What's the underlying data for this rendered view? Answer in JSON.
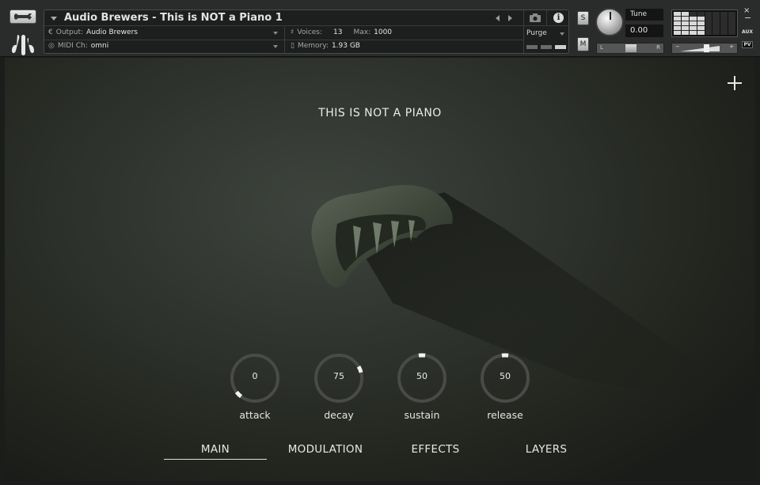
{
  "header": {
    "instrument_title": "Audio Brewers - This is NOT a Piano 1",
    "output_label": "Output:",
    "output_value": "Audio Brewers",
    "midi_label": "MIDI Ch:",
    "midi_value": "omni",
    "voices_label": "Voices:",
    "voices_value": "13",
    "max_label": "Max:",
    "max_value": "1000",
    "memory_label": "Memory:",
    "memory_value": "1.93 GB",
    "purge_label": "Purge",
    "solo_label": "S",
    "mute_label": "M",
    "tune_label": "Tune",
    "tune_value": "0.00",
    "pan_left": "L",
    "pan_right": "R",
    "vol_minus": "−",
    "vol_plus": "+",
    "close_label": "×",
    "aux_label": "AUX",
    "pv_label": "PV",
    "output_glyph": "€",
    "voices_glyph": "♯",
    "memory_glyph": "▯",
    "midi_glyph": "◎",
    "info_glyph": "i"
  },
  "main": {
    "title": "THIS IS NOT A PIANO",
    "knobs": [
      {
        "label": "attack",
        "value": "0",
        "fraction": 0.0
      },
      {
        "label": "decay",
        "value": "75",
        "fraction": 0.75
      },
      {
        "label": "sustain",
        "value": "50",
        "fraction": 0.5
      },
      {
        "label": "release",
        "value": "50",
        "fraction": 0.5
      }
    ]
  },
  "tabs": [
    {
      "label": "MAIN",
      "active": true
    },
    {
      "label": "MODULATION",
      "active": false
    },
    {
      "label": "EFFECTS",
      "active": false
    },
    {
      "label": "LAYERS",
      "active": false
    }
  ],
  "colors": {
    "accent": "#e0e0e0",
    "background": "#2f332e",
    "knob_ring": "#4a4a4a",
    "knob_indicator": "#f2f2f2"
  },
  "icons": [
    "wrench-icon",
    "logo-icon",
    "camera-icon",
    "info-icon",
    "plus-icon",
    "close-icon"
  ]
}
